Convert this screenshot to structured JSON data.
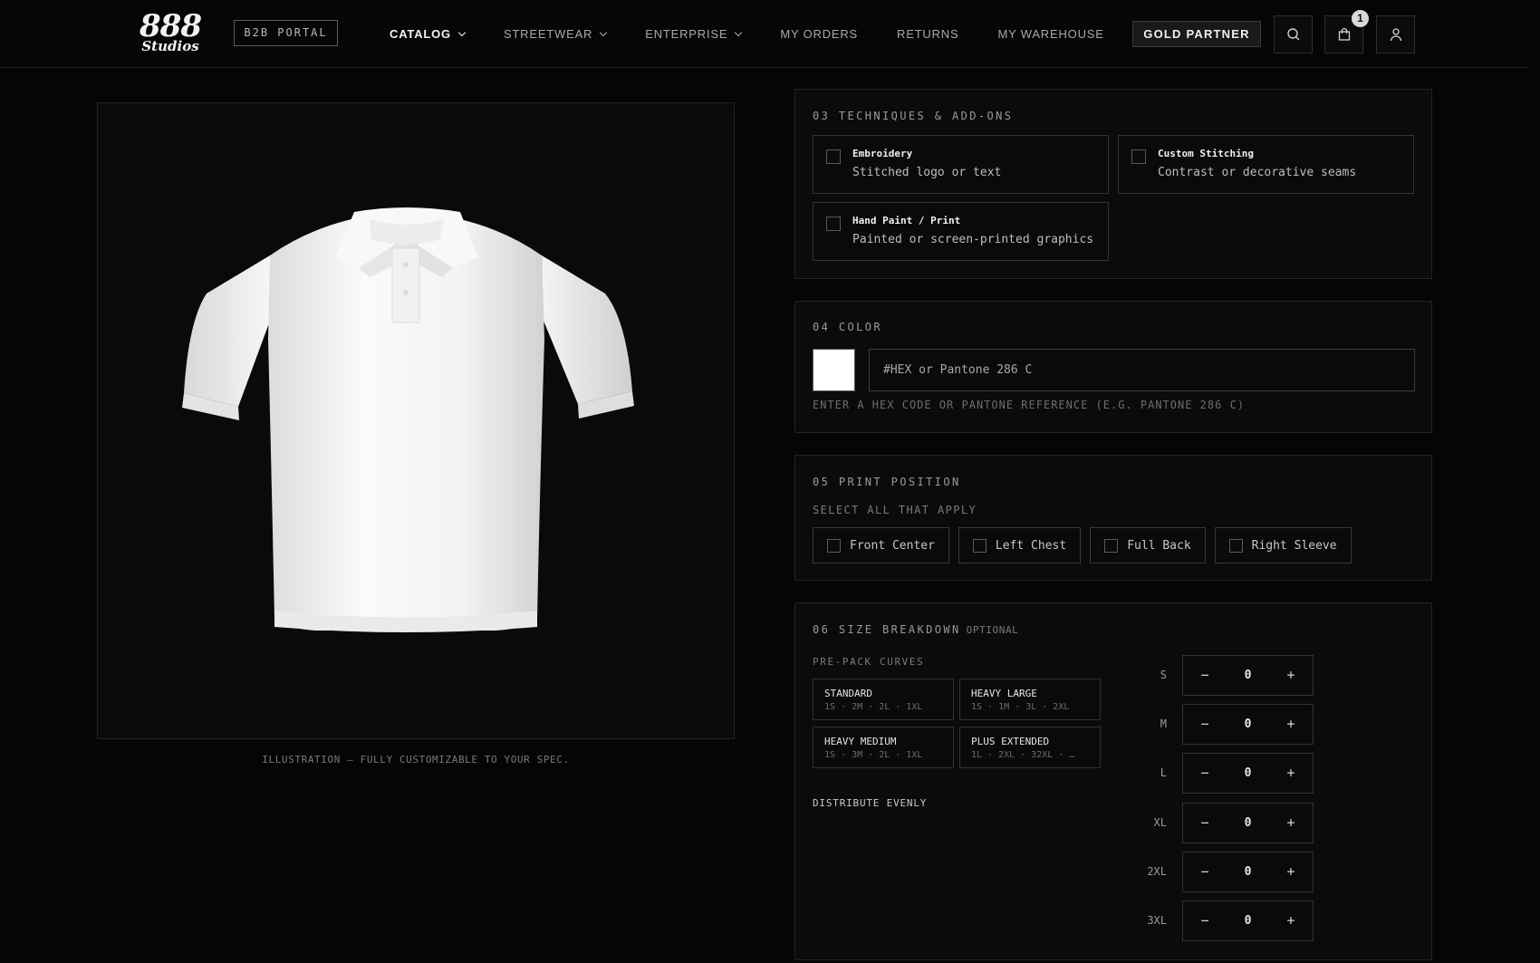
{
  "brand": {
    "logo_number": "888",
    "logo_word": "Studios",
    "portal_badge": "B2B PORTAL"
  },
  "nav": [
    {
      "label": "CATALOG",
      "active": true,
      "has_dropdown": true
    },
    {
      "label": "STREETWEAR",
      "active": false,
      "has_dropdown": true
    },
    {
      "label": "ENTERPRISE",
      "active": false,
      "has_dropdown": true
    },
    {
      "label": "MY ORDERS",
      "active": false,
      "has_dropdown": false
    },
    {
      "label": "RETURNS",
      "active": false,
      "has_dropdown": false
    },
    {
      "label": "MY WAREHOUSE",
      "active": false,
      "has_dropdown": false
    }
  ],
  "header_actions": {
    "partner_label": "GOLD PARTNER",
    "cart_count": "1",
    "icons": [
      "search-icon",
      "cart-icon",
      "user-icon"
    ]
  },
  "product": {
    "image": "white-polo-shirt",
    "caption": "ILLUSTRATION — FULLY CUSTOMIZABLE TO YOUR SPEC."
  },
  "techniques": {
    "title": "03 TECHNIQUES & ADD-ONS",
    "items": [
      {
        "title": "Embroidery",
        "desc": "Stitched logo or text",
        "checked": false
      },
      {
        "title": "Custom Stitching",
        "desc": "Contrast or decorative seams",
        "checked": false
      },
      {
        "title": "Hand Paint / Print",
        "desc": "Painted or screen-printed graphics",
        "checked": false
      }
    ]
  },
  "color": {
    "title": "04 COLOR",
    "swatch": "#ffffff",
    "input_value": "",
    "placeholder": "#HEX or Pantone 286 C",
    "hint": "ENTER A HEX CODE OR PANTONE REFERENCE (E.G. PANTONE 286 C)"
  },
  "print_position": {
    "title": "05 PRINT POSITION",
    "subtitle": "SELECT ALL THAT APPLY",
    "options": [
      {
        "label": "Front Center",
        "checked": false
      },
      {
        "label": "Left Chest",
        "checked": false
      },
      {
        "label": "Full Back",
        "checked": false
      },
      {
        "label": "Right Sleeve",
        "checked": false
      }
    ]
  },
  "size_breakdown": {
    "title": "06 SIZE BREAKDOWN",
    "optional": "OPTIONAL",
    "curves_label": "PRE-PACK CURVES",
    "curves": [
      {
        "name": "STANDARD",
        "values": "1S · 2M · 2L · 1XL"
      },
      {
        "name": "HEAVY LARGE",
        "values": "1S · 1M · 3L · 2XL"
      },
      {
        "name": "HEAVY MEDIUM",
        "values": "1S · 3M · 2L · 1XL"
      },
      {
        "name": "PLUS EXTENDED",
        "values": "1L · 2XL · 32XL · …"
      }
    ],
    "distribute_label": "DISTRIBUTE EVENLY",
    "sizes": [
      {
        "label": "S",
        "qty": "0"
      },
      {
        "label": "M",
        "qty": "0"
      },
      {
        "label": "L",
        "qty": "0"
      },
      {
        "label": "XL",
        "qty": "0"
      },
      {
        "label": "2XL",
        "qty": "0"
      },
      {
        "label": "3XL",
        "qty": "0"
      }
    ],
    "minus_glyph": "−",
    "plus_glyph": "+"
  }
}
